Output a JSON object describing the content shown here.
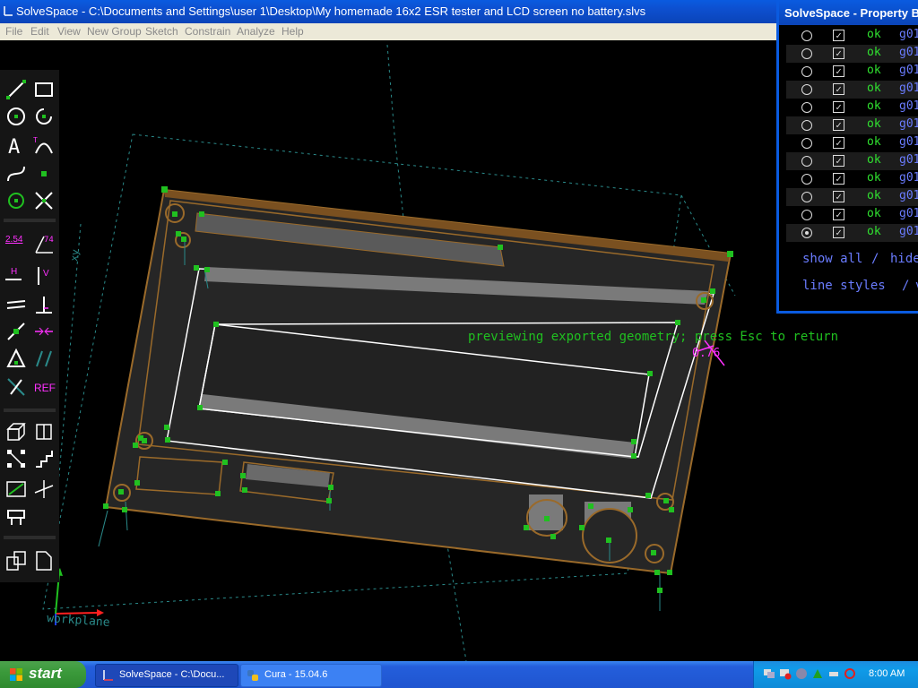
{
  "window": {
    "title": "SolveSpace - C:\\Documents and Settings\\user 1\\Desktop\\My homemade 16x2 ESR tester and LCD screen no battery.slvs"
  },
  "menu": {
    "items": [
      "File",
      "Edit",
      "View",
      "New Group",
      "Sketch",
      "Constrain",
      "Analyze",
      "Help"
    ]
  },
  "toolbar": {
    "labels": {
      "dimension": "2.54",
      "angle": "74°",
      "horizontal": "H",
      "vertical": "V",
      "reference": "REF"
    }
  },
  "canvas": {
    "overlay_message": "previewing exported geometry; press Esc to return",
    "dimension_label": "0.76",
    "workplane_label": "workplane",
    "axis_label": "xy"
  },
  "property_browser": {
    "title": "SolveSpace - Property Br",
    "rows": [
      {
        "status": "ok",
        "group": "g01",
        "active": false
      },
      {
        "status": "ok",
        "group": "g01",
        "active": false
      },
      {
        "status": "ok",
        "group": "g01",
        "active": false
      },
      {
        "status": "ok",
        "group": "g01",
        "active": false
      },
      {
        "status": "ok",
        "group": "g01",
        "active": false
      },
      {
        "status": "ok",
        "group": "g01",
        "active": false
      },
      {
        "status": "ok",
        "group": "g01",
        "active": false
      },
      {
        "status": "ok",
        "group": "g01",
        "active": false
      },
      {
        "status": "ok",
        "group": "g01",
        "active": false
      },
      {
        "status": "ok",
        "group": "g01",
        "active": false
      },
      {
        "status": "ok",
        "group": "g01",
        "active": false
      },
      {
        "status": "ok",
        "group": "g01",
        "active": true
      }
    ],
    "show_all": "show all",
    "slash1": "/",
    "hide": "hide",
    "line_styles": "line styles",
    "slash2": "/",
    "v": "v"
  },
  "taskbar": {
    "start": "start",
    "tasks": [
      {
        "label": "SolveSpace - C:\\Docu...",
        "active": true
      },
      {
        "label": "Cura - 15.04.6",
        "active": false
      }
    ],
    "clock": "8:00 AM"
  },
  "colors": {
    "accent": "#0a5be0",
    "green": "#30e030",
    "magenta": "#ff30ff",
    "brown": "#9a6a2a",
    "link": "#6a7cff"
  }
}
